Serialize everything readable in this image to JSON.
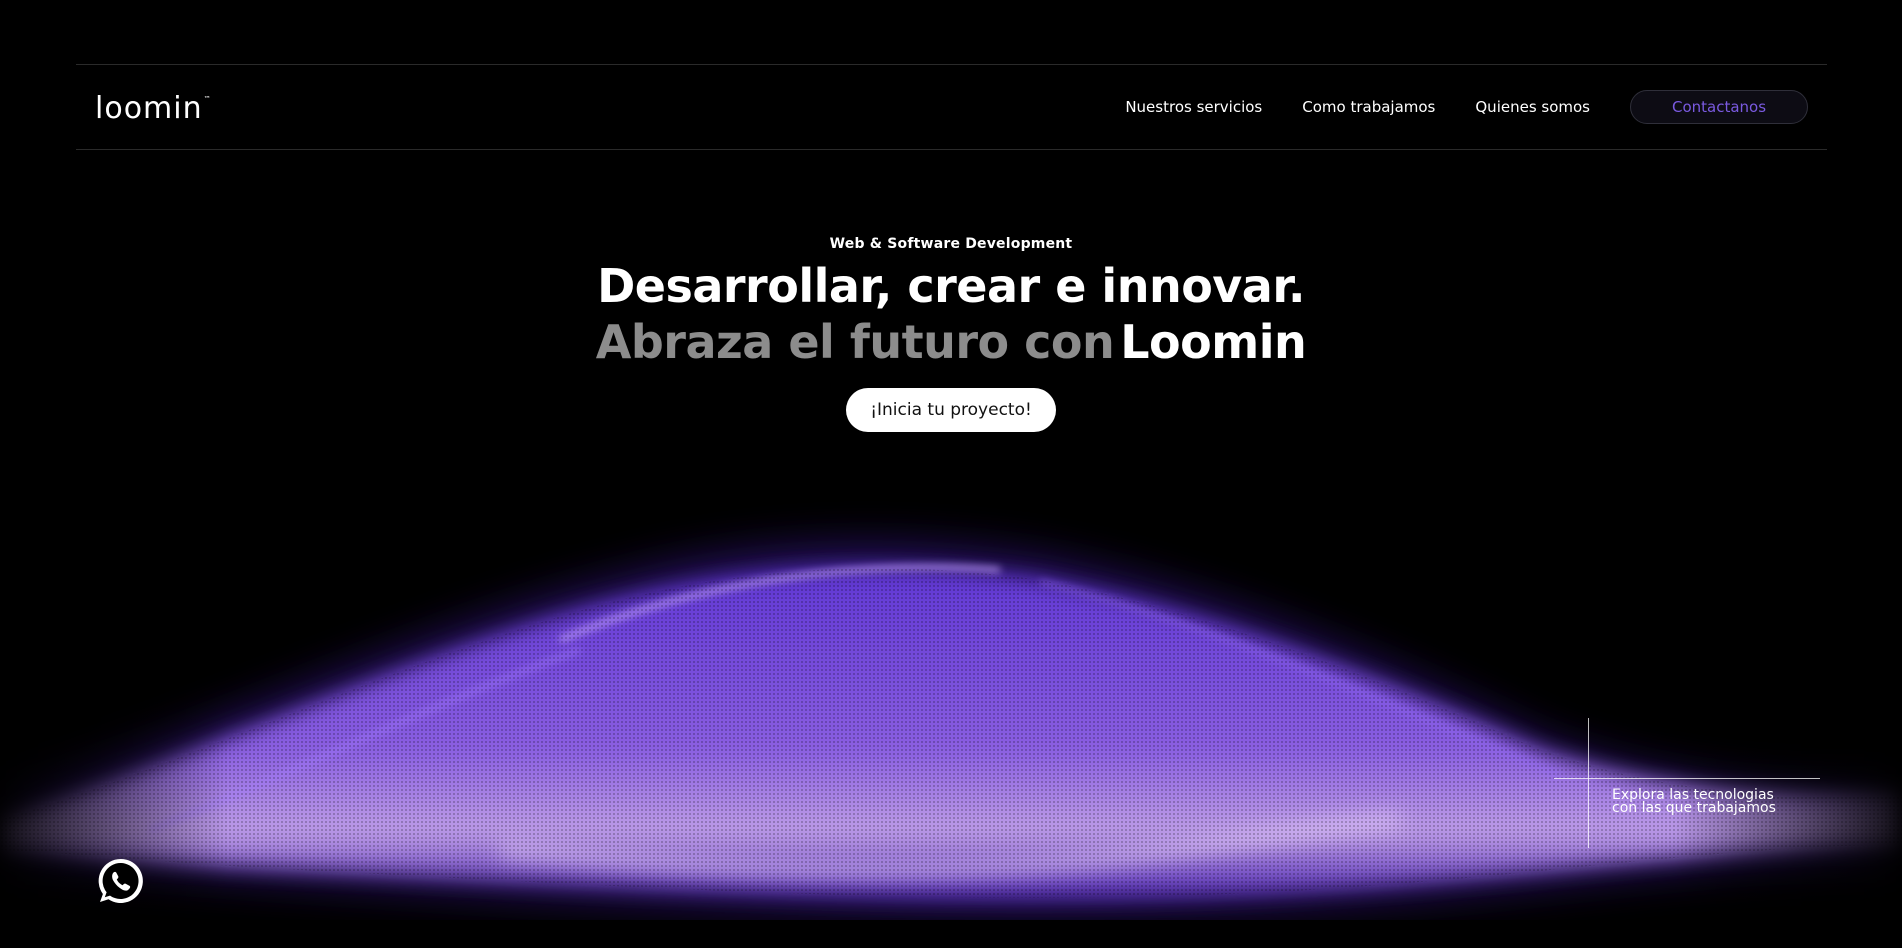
{
  "header": {
    "logo_text": "loomin",
    "logo_mark": "™",
    "nav": [
      {
        "label": "Nuestros servicios"
      },
      {
        "label": "Como trabajamos"
      },
      {
        "label": "Quienes somos"
      }
    ],
    "contact_label": "Contactanos"
  },
  "hero": {
    "eyebrow": "Web & Software Development",
    "headline_line1": "Desarrollar, crear e innovar.",
    "headline_line2_muted": "Abraza el futuro con",
    "headline_line2_brand": "Loomin",
    "cta_label": "¡Inicia tu proyecto!"
  },
  "explore": {
    "line1": "Explora las tecnologias",
    "line2": "con las que trabajamos"
  },
  "icons": {
    "whatsapp": "whatsapp-icon"
  },
  "colors": {
    "background": "#000000",
    "accent": "#7a5ae0",
    "wave": "#8a5cf5",
    "muted_text": "#8c8c8c"
  }
}
